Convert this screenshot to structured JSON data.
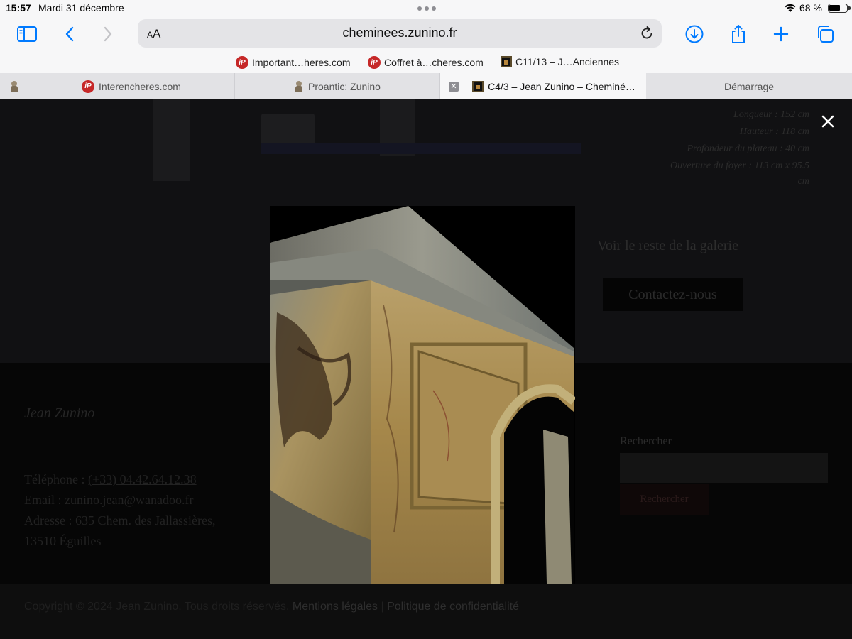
{
  "status": {
    "time": "15:57",
    "date": "Mardi 31 décembre",
    "battery_pct": "68 %",
    "battery_level": 0.68
  },
  "toolbar": {
    "text_size_label": "AA",
    "url": "cheminees.zunino.fr",
    "icons": [
      "sidebar-icon",
      "back-icon",
      "forward-icon",
      "reload-icon",
      "download-icon",
      "share-icon",
      "new-tab-icon",
      "tabs-overview-icon"
    ]
  },
  "bookmarks": [
    {
      "label": "Important…heres.com",
      "icon": "interencheres-icon"
    },
    {
      "label": "Coffret à…cheres.com",
      "icon": "interencheres-icon"
    },
    {
      "label": "C11/13 – J…Anciennes",
      "icon": "fireplace-icon"
    }
  ],
  "tabs": [
    {
      "label": "",
      "icon": "statue-icon"
    },
    {
      "label": "Interencheres.com",
      "icon": "interencheres-icon"
    },
    {
      "label": "Proantic: Zunino",
      "icon": "statue-icon"
    },
    {
      "label": "C4/3 – Jean Zunino – Cheminé…",
      "icon": "fireplace-icon",
      "active": true
    },
    {
      "label": "Démarrage"
    }
  ],
  "product": {
    "specs": [
      "Longueur : 152 cm",
      "Hauteur : 118 cm",
      "Profondeur du plateau : 40 cm",
      "Ouverture du foyer : 113 cm x 95.5",
      "cm"
    ],
    "gallery_link": "Voir le reste de la galerie",
    "contact_button": "Contactez-nous"
  },
  "footer": {
    "logo_text": "Jean Zunino",
    "phone_label": "Téléphone : ",
    "phone": "(+33) 04.42.64.12.38",
    "email": "Email : zunino.jean@wanadoo.fr",
    "address_1": "Adresse : 635 Chem. des Jallassières,",
    "address_2": "13510 Éguilles",
    "search_label": "Rechercher",
    "search_value": "",
    "search_button": "Rechercher"
  },
  "copyright": {
    "text": "Copyright © 2024 Jean Zunino. Tous droits réservés.",
    "legal_link": "Mentions légales",
    "separator": "|",
    "privacy_link": "Politique de confidentialité"
  },
  "lightbox": {
    "close_icon": "close-icon",
    "image": "marble-fireplace-photo"
  },
  "colors": {
    "chrome_bg": "#f7f7f8",
    "accent_blue": "#007aff",
    "overlay": "#000000",
    "marble_ochre": "#b4913e",
    "marble_grey": "#8a8f86"
  }
}
